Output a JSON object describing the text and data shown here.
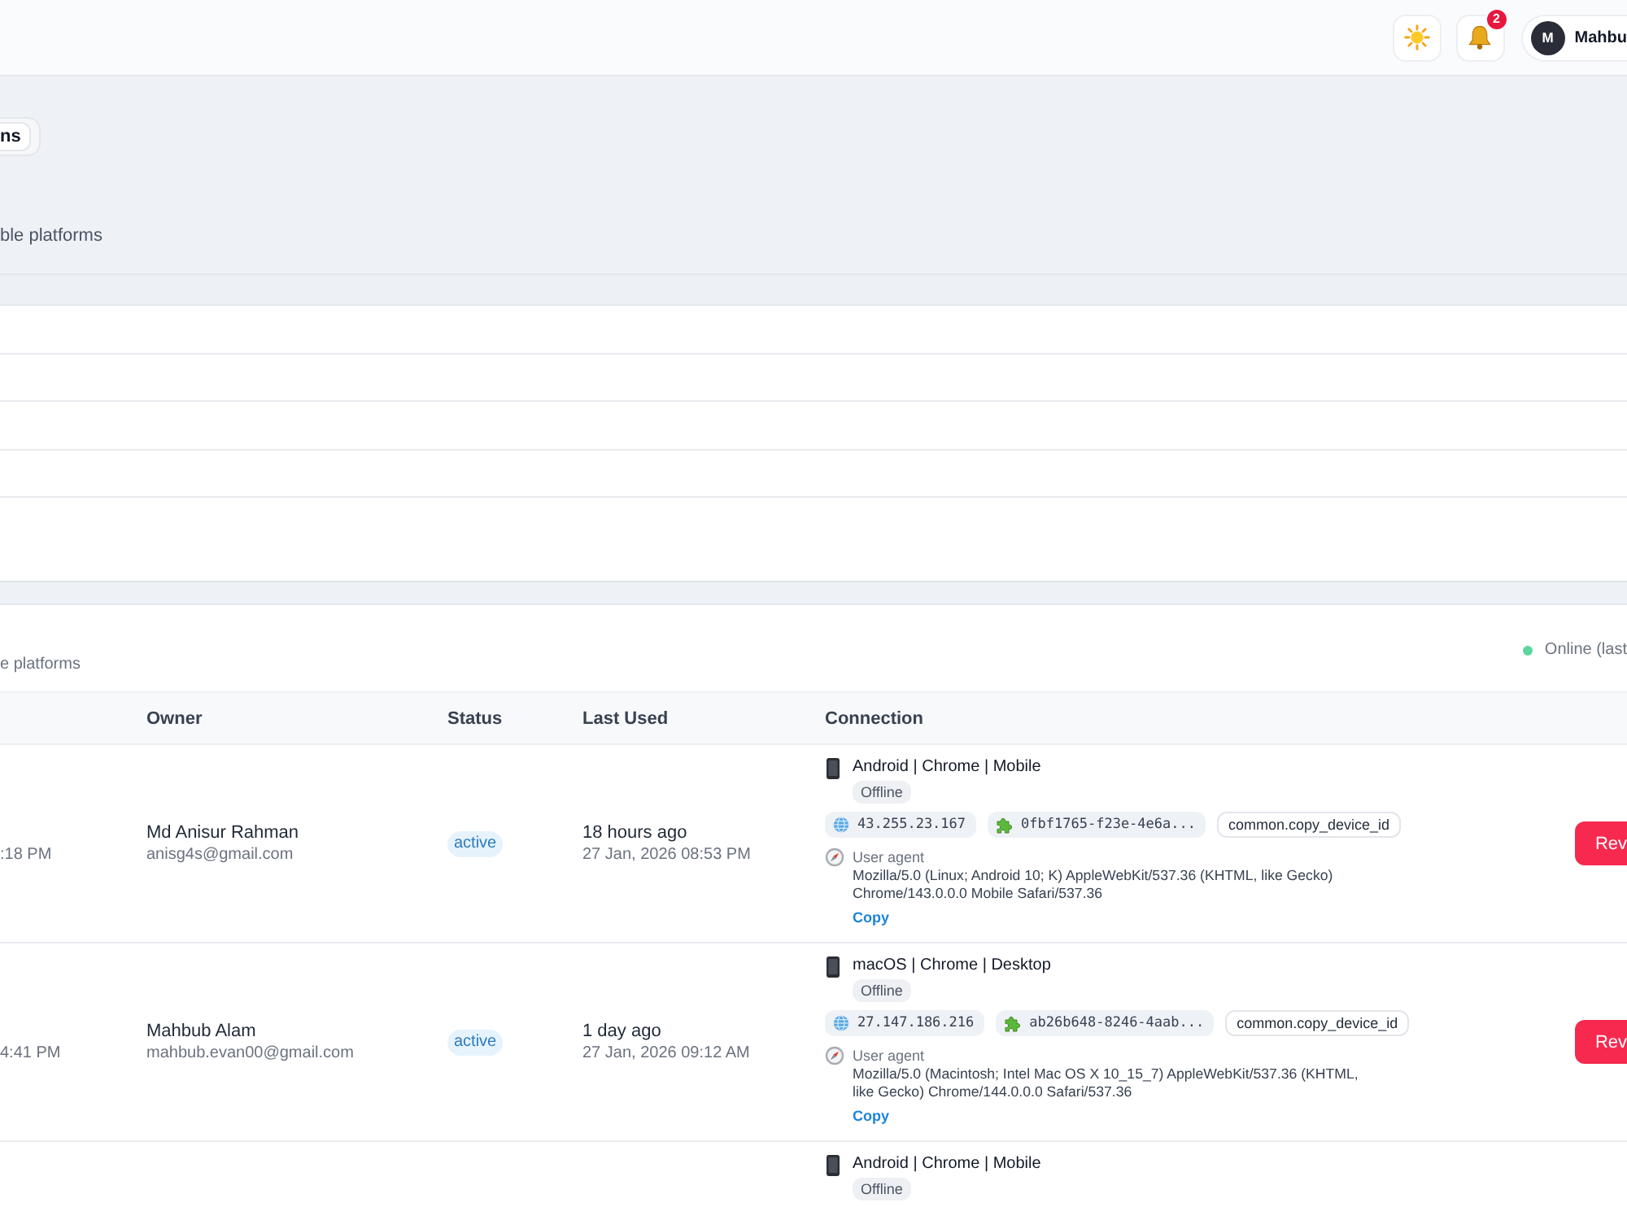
{
  "top_bar": {
    "notification_count": "2",
    "user": {
      "initial": "M",
      "name": "Mahbu"
    }
  },
  "tabs": [
    {
      "label": "ns",
      "selected": true
    }
  ],
  "upper_section": {
    "subtitle": "ble platforms"
  },
  "sessions": {
    "subtitle": "e platforms",
    "online_legend": "Online (last",
    "columns": [
      "Owner",
      "Status",
      "Last Used",
      "Connection"
    ],
    "rows": [
      {
        "column_1": ":18 PM",
        "owner": {
          "name": "Md Anisur Rahman",
          "email": "anisg4s@gmail.com"
        },
        "status": "active",
        "last_used": {
          "relative": "18 hours ago",
          "date": "27 Jan, 2026 08:53 PM"
        },
        "connection": {
          "device": "Android | Chrome | Mobile",
          "presence": "Offline",
          "ip": "43.255.23.167",
          "device_id": "0fbf1765-f23e-4e6a...",
          "copy_id_button": "common.copy_device_id",
          "user_agent_label": "User agent",
          "user_agent": "Mozilla/5.0 (Linux; Android 10; K) AppleWebKit/537.36 (KHTML, like Gecko) Chrome/143.0.0.0 Mobile Safari/537.36",
          "copy_link": "Copy"
        },
        "action": "Rev"
      },
      {
        "column_1": "4:41 PM",
        "owner": {
          "name": "Mahbub Alam",
          "email": "mahbub.evan00@gmail.com"
        },
        "status": "active",
        "last_used": {
          "relative": "1 day ago",
          "date": "27 Jan, 2026 09:12 AM"
        },
        "connection": {
          "device": "macOS | Chrome | Desktop",
          "presence": "Offline",
          "ip": "27.147.186.216",
          "device_id": "ab26b648-8246-4aab...",
          "copy_id_button": "common.copy_device_id",
          "user_agent_label": "User agent",
          "user_agent": "Mozilla/5.0 (Macintosh; Intel Mac OS X 10_15_7) AppleWebKit/537.36 (KHTML, like Gecko) Chrome/144.0.0.0 Safari/537.36",
          "copy_link": "Copy"
        },
        "action": "Rev"
      },
      {
        "connection": {
          "device": "Android | Chrome | Mobile",
          "presence": "Offline"
        }
      }
    ]
  }
}
